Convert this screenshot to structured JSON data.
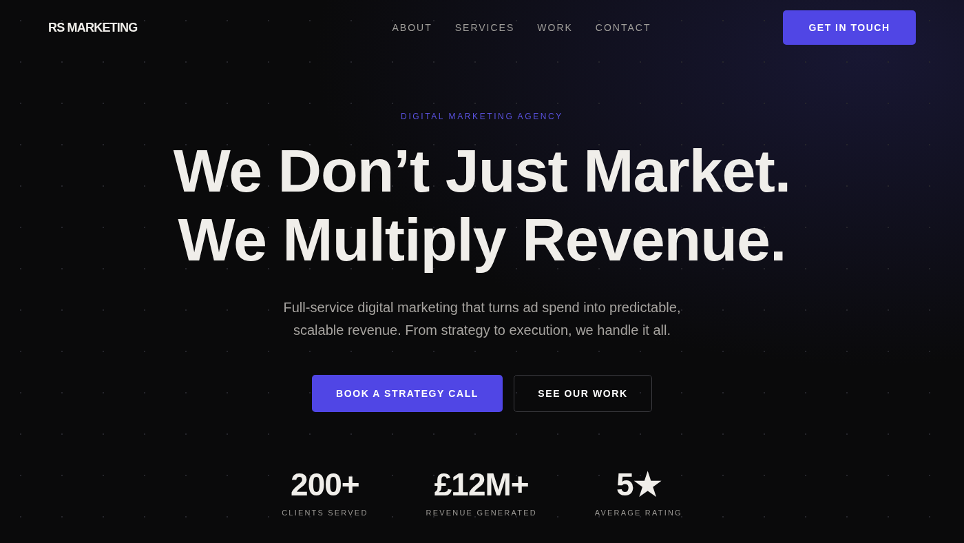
{
  "brand": "RS MARKETING",
  "nav": [
    {
      "label": "ABOUT"
    },
    {
      "label": "SERVICES"
    },
    {
      "label": "WORK"
    },
    {
      "label": "CONTACT"
    }
  ],
  "cta": "GET IN TOUCH",
  "eyebrow": "DIGITAL MARKETING AGENCY",
  "headline": [
    "We Don’t Just Market.",
    "We Multiply Revenue."
  ],
  "subtitle": [
    "Full-service digital marketing that turns ad spend into predictable,",
    "scalable revenue. From strategy to execution, we handle it all."
  ],
  "buttons": [
    {
      "label": "BOOK A STRATEGY CALL",
      "kind": "primary"
    },
    {
      "label": "SEE OUR WORK",
      "kind": "outline"
    }
  ],
  "stats": [
    {
      "value": "200+",
      "label": "CLIENTS SERVED"
    },
    {
      "value": "£12M+",
      "label": "REVENUE GENERATED"
    },
    {
      "value": "5★",
      "label": "AVERAGE RATING"
    }
  ]
}
